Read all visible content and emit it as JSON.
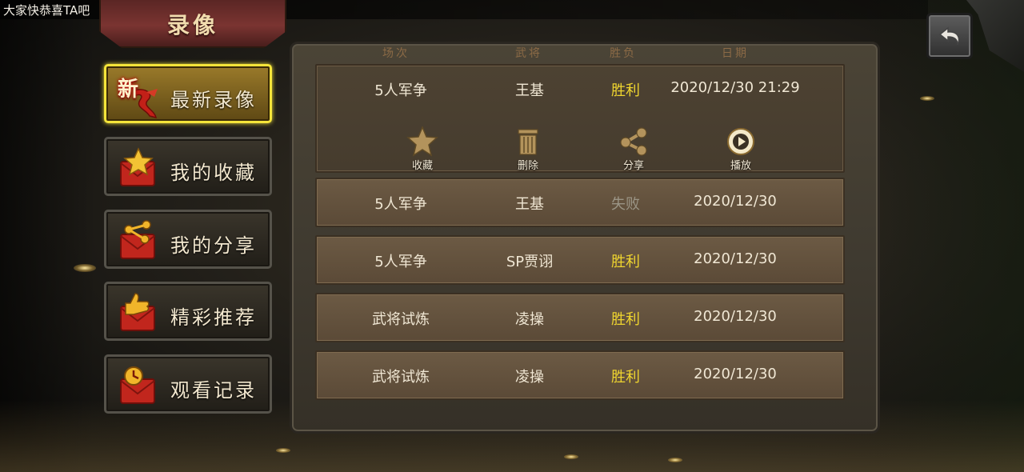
{
  "notice": "大家快恭喜TA吧",
  "title": "录像",
  "menu": [
    {
      "label": "最新录像",
      "badge": "新",
      "active": true
    },
    {
      "label": "我的收藏",
      "active": false
    },
    {
      "label": "我的分享",
      "active": false
    },
    {
      "label": "精彩推荐",
      "active": false
    },
    {
      "label": "观看记录",
      "active": false
    }
  ],
  "table": {
    "headers": [
      "场次",
      "武将",
      "胜负",
      "日期"
    ],
    "rows": [
      {
        "mode": "5人军争",
        "general": "王基",
        "result": "胜利",
        "date": "2020/12/30  21:29"
      },
      {
        "mode": "5人军争",
        "general": "王基",
        "result": "失败",
        "date": "2020/12/30"
      },
      {
        "mode": "5人军争",
        "general": "SP贾诩",
        "result": "胜利",
        "date": "2020/12/30"
      },
      {
        "mode": "武将试炼",
        "general": "凌操",
        "result": "胜利",
        "date": "2020/12/30"
      },
      {
        "mode": "武将试炼",
        "general": "凌操",
        "result": "胜利",
        "date": "2020/12/30"
      }
    ]
  },
  "actions": {
    "favorite": "收藏",
    "delete": "删除",
    "share": "分享",
    "play": "播放"
  },
  "colors": {
    "win": "#efd52f",
    "lose": "#9a9485",
    "active_border": "#f4e43a",
    "title_banner": "#7a3431"
  },
  "icons": {
    "back": "back-arrow-icon",
    "favorite": "star-icon",
    "delete": "trash-icon",
    "share": "share-icon",
    "play": "play-icon"
  }
}
